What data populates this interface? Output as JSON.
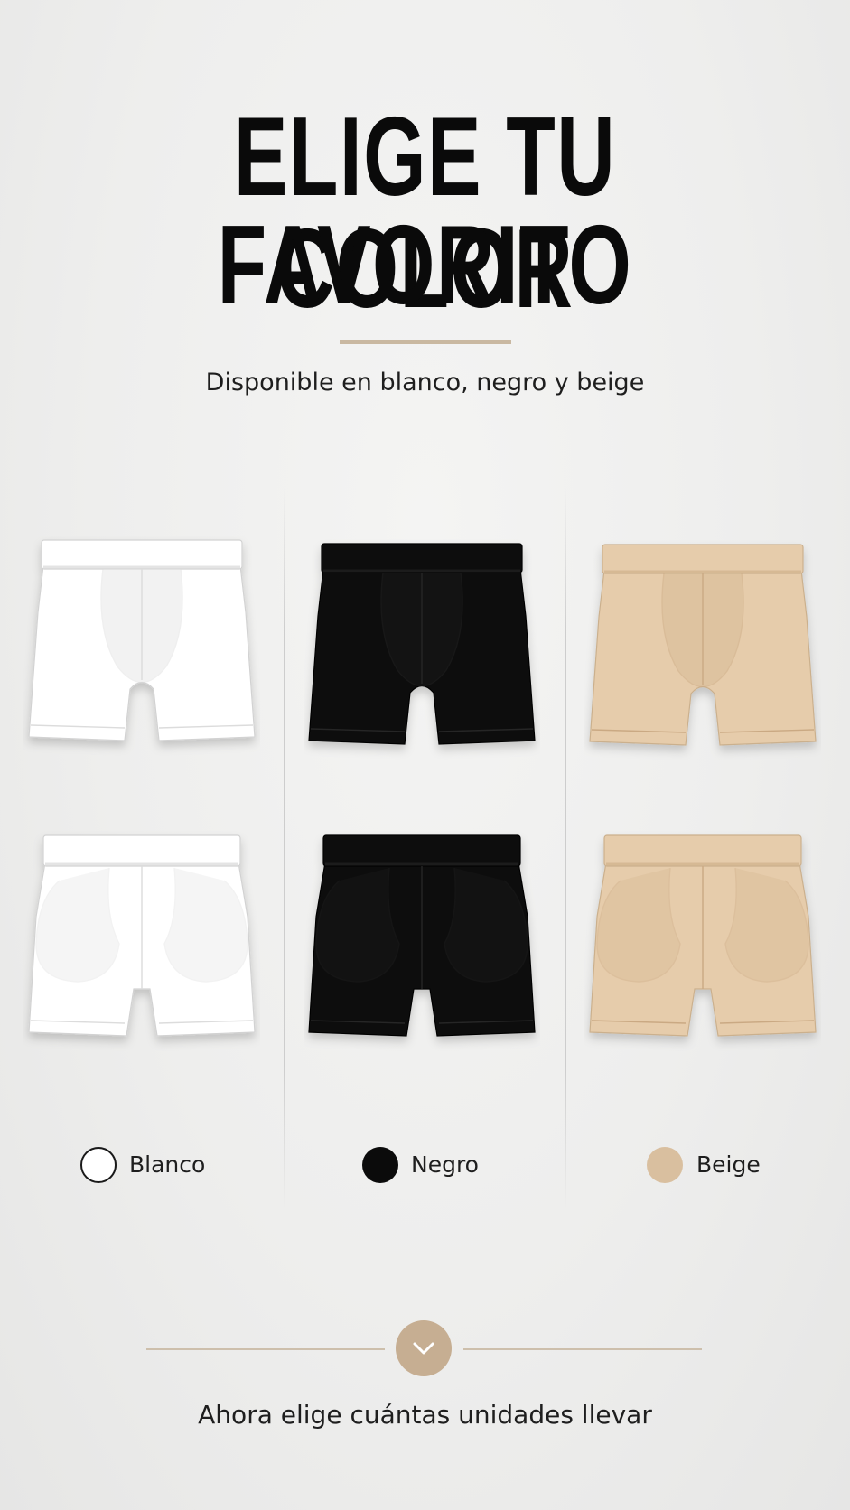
{
  "header": {
    "title_line1": "ELIGE TU COLOR",
    "title_line2": "FAVORITO",
    "subtitle": "Disponible en blanco, negro y beige"
  },
  "colors": [
    {
      "name": "Blanco",
      "hex": "#ffffff",
      "shade": "#e4e4e4",
      "stroke": "#d2d2d2",
      "seam": "#dcdcdc"
    },
    {
      "name": "Negro",
      "hex": "#0b0b0b",
      "shade": "#1c1c1c",
      "stroke": "#050505",
      "seam": "#262626"
    },
    {
      "name": "Beige",
      "hex": "#e6ccab",
      "shade": "#d6b994",
      "stroke": "#cbb08d",
      "seam": "#caa983"
    }
  ],
  "footer": {
    "text": "Ahora elige cuántas unidades llevar",
    "icon": "chevron-down-icon"
  },
  "accent_color": "#c6ae92"
}
